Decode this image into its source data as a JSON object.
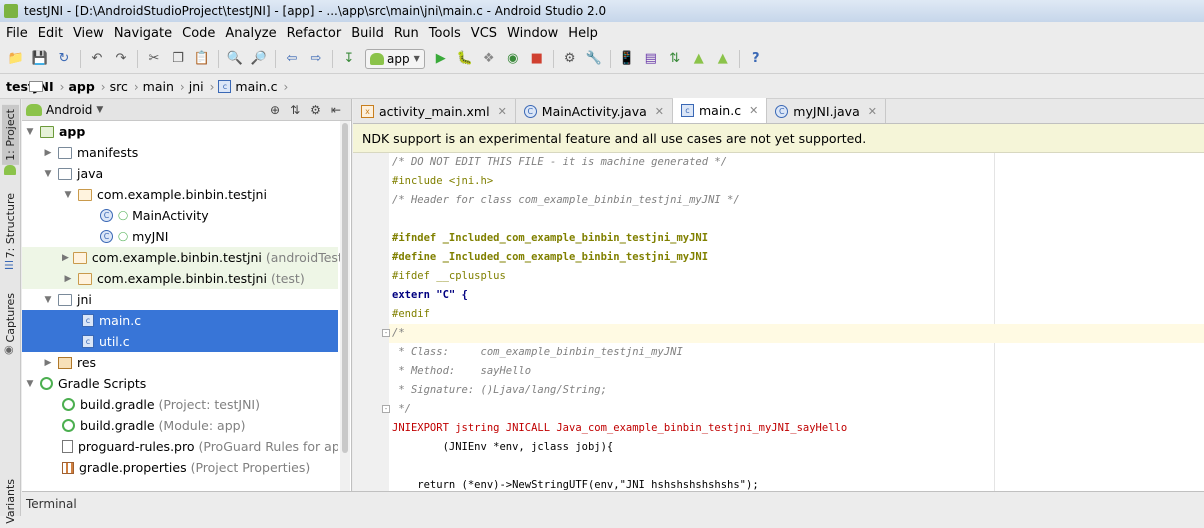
{
  "window": {
    "title": "testJNI - [D:\\AndroidStudioProject\\testJNI] - [app] - ...\\app\\src\\main\\jni\\main.c - Android Studio 2.0"
  },
  "menu": [
    "File",
    "Edit",
    "View",
    "Navigate",
    "Code",
    "Analyze",
    "Refactor",
    "Build",
    "Run",
    "Tools",
    "VCS",
    "Window",
    "Help"
  ],
  "toolbar": {
    "run_config": "app"
  },
  "breadcrumb": [
    "testJNI",
    "app",
    "src",
    "main",
    "jni",
    "main.c"
  ],
  "left_tabs": [
    "1: Project",
    "7: Structure",
    "Captures",
    "Variants"
  ],
  "project_panel": {
    "view_label": "Android"
  },
  "tree": [
    {
      "label": "app",
      "extra": ""
    },
    {
      "label": "manifests",
      "extra": ""
    },
    {
      "label": "java",
      "extra": ""
    },
    {
      "label": "com.example.binbin.testjni",
      "extra": ""
    },
    {
      "label": "MainActivity",
      "extra": ""
    },
    {
      "label": "myJNI",
      "extra": ""
    },
    {
      "label": "com.example.binbin.testjni",
      "extra": "(androidTest)"
    },
    {
      "label": "com.example.binbin.testjni",
      "extra": "(test)"
    },
    {
      "label": "jni",
      "extra": ""
    },
    {
      "label": "main.c",
      "extra": ""
    },
    {
      "label": "util.c",
      "extra": ""
    },
    {
      "label": "res",
      "extra": ""
    },
    {
      "label": "Gradle Scripts",
      "extra": ""
    },
    {
      "label": "build.gradle",
      "extra": "(Project: testJNI)"
    },
    {
      "label": "build.gradle",
      "extra": "(Module: app)"
    },
    {
      "label": "proguard-rules.pro",
      "extra": "(ProGuard Rules for app)"
    },
    {
      "label": "gradle.properties",
      "extra": "(Project Properties)"
    }
  ],
  "editor_tabs": [
    "activity_main.xml",
    "MainActivity.java",
    "main.c",
    "myJNI.java"
  ],
  "banner": "NDK support is an experimental feature and all use cases are not yet supported.",
  "code": [
    "/* DO NOT EDIT THIS FILE - it is machine generated */",
    "#include <jni.h>",
    "/* Header for class com_example_binbin_testjni_myJNI */",
    "",
    "#ifndef _Included_com_example_binbin_testjni_myJNI",
    "#define _Included_com_example_binbin_testjni_myJNI",
    "#ifdef __cplusplus",
    "extern \"C\" {",
    "#endif",
    "/*",
    " * Class:     com_example_binbin_testjni_myJNI",
    " * Method:    sayHello",
    " * Signature: ()Ljava/lang/String;",
    " */",
    "JNIEXPORT jstring JNICALL Java_com_example_binbin_testjni_myJNI_sayHello",
    "        (JNIEnv *env, jclass jobj){",
    "",
    "    return (*env)->NewStringUTF(env,\"JNI hshshshshshshs\");"
  ],
  "bottom": {
    "terminal_label": "Terminal"
  }
}
